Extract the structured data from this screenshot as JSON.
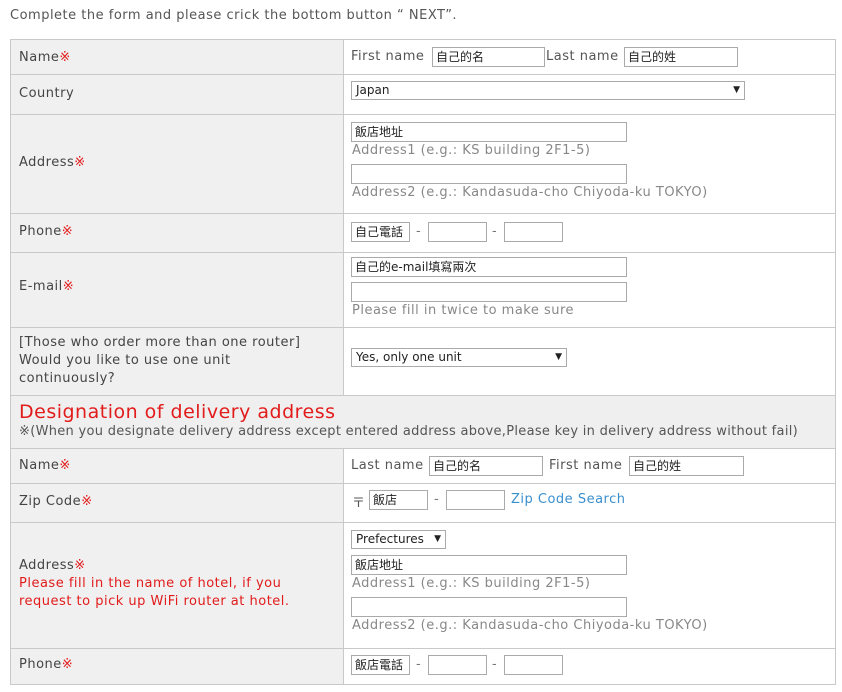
{
  "intro": "Complete the form and please crick the bottom button “ NEXT”.",
  "required_mark": "※",
  "name": {
    "label": "Name",
    "first_label": "First name",
    "first_value": "自己的名",
    "last_label": "Last name",
    "last_value": "自己的姓"
  },
  "country": {
    "label": "Country",
    "selected": "Japan"
  },
  "address": {
    "label": "Address",
    "address1_value": "飯店地址",
    "address1_hint": "Address1 (e.g.: KS building 2F1-5)",
    "address2_value": "",
    "address2_hint": "Address2 (e.g.: Kandasuda-cho Chiyoda-ku TOKYO)"
  },
  "phone": {
    "label": "Phone",
    "part1": "自己電話",
    "part2": "",
    "part3": "",
    "separator": "-"
  },
  "email": {
    "label": "E-mail",
    "value": "自己的e-mail填寫兩次",
    "confirm_value": "",
    "note": "Please fill in twice to make sure"
  },
  "router": {
    "label_line1": "[Those who order more than one router]",
    "label_line2": "Would you like to use one unit",
    "label_line3": "continuously?",
    "selected": "Yes, only one unit"
  },
  "delivery": {
    "title": "Designation of delivery address",
    "note": "※(When you designate delivery address except entered address above,Please key in delivery address without fail)",
    "name": {
      "label": "Name",
      "last_label": "Last name",
      "last_value": "自己的名",
      "first_label": "First name",
      "first_value": "自己的姓"
    },
    "zip": {
      "label": "Zip Code",
      "symbol": "〒",
      "part1": "飯店",
      "part2": "",
      "search_link": "Zip Code Search"
    },
    "address": {
      "label": "Address",
      "hotel_note_line1": "Please fill in the name of hotel, if you",
      "hotel_note_line2": "request to pick up WiFi router at hotel.",
      "prefecture_selected": "Prefectures",
      "address1_value": "飯店地址",
      "address1_hint": "Address1 (e.g.: KS building 2F1-5)",
      "address2_value": "",
      "address2_hint": "Address2 (e.g.: Kandasuda-cho Chiyoda-ku TOKYO)"
    },
    "phone": {
      "label": "Phone",
      "part1": "飯店電話",
      "part2": "",
      "part3": "",
      "separator": "-"
    }
  },
  "icons": {
    "dropdown": "chevron-down-icon"
  }
}
